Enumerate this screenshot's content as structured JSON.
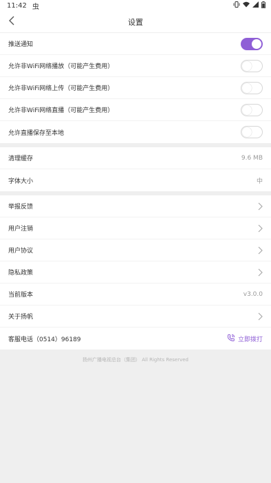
{
  "status_bar": {
    "time": "11:42",
    "notification_glyph": "虫",
    "icons": [
      "vibrate-icon",
      "wifi-icon",
      "signal-icon",
      "battery-icon"
    ]
  },
  "nav": {
    "title": "设置",
    "back_icon": "back-arrow-icon"
  },
  "groups": {
    "toggles": [
      {
        "label": "推送通知",
        "on": true
      },
      {
        "label": "允许非WiFi网络播放（可能产生费用）",
        "on": false
      },
      {
        "label": "允许非WiFi网络上传（可能产生费用）",
        "on": false
      },
      {
        "label": "允许非WiFi网络直播（可能产生费用）",
        "on": false
      },
      {
        "label": "允许直播保存至本地",
        "on": false
      }
    ],
    "storage": [
      {
        "label": "清理缓存",
        "value": "9.6 MB"
      },
      {
        "label": "字体大小",
        "value": "中"
      }
    ],
    "about": [
      {
        "label": "举报反馈"
      },
      {
        "label": "用户注销"
      },
      {
        "label": "用户协议"
      },
      {
        "label": "隐私政策"
      },
      {
        "label": "当前版本",
        "value": "v3.0.0"
      },
      {
        "label": "关于扬帆"
      }
    ],
    "hotline": {
      "label": "客服电话（0514）96189",
      "action": "立即拨打",
      "icon": "phone-call-icon"
    }
  },
  "footer": {
    "copyright": "扬州广播电视总台（集团） All Rights Reserved"
  },
  "colors": {
    "accent": "#8f5fd6",
    "background": "#efefef",
    "card": "#ffffff",
    "secondary_text": "#999999"
  }
}
